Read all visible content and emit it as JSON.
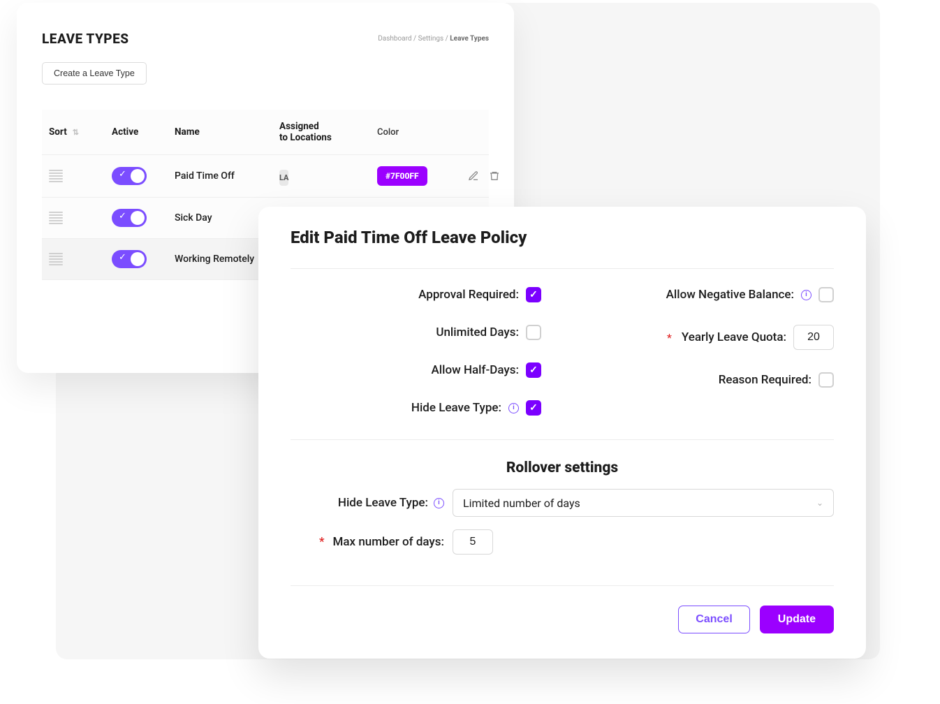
{
  "page": {
    "title": "LEAVE TYPES",
    "breadcrumb": {
      "parts": [
        "Dashboard",
        "Settings"
      ],
      "current": "Leave Types",
      "sep": " / "
    },
    "create_button": "Create a Leave Type",
    "columns": {
      "sort": "Sort",
      "active": "Active",
      "name": "Name",
      "locations_l1": "Assigned",
      "locations_l2": "to Locations",
      "color": "Color"
    },
    "rows": [
      {
        "name": "Paid Time Off",
        "location": "LA",
        "color_hex": "#7F00FF",
        "active": true
      },
      {
        "name": "Sick Day",
        "active": true
      },
      {
        "name": "Working Remotely",
        "active": true
      }
    ]
  },
  "modal": {
    "title": "Edit Paid Time Off Leave Policy",
    "left": {
      "approval_required": {
        "label": "Approval Required:",
        "checked": true
      },
      "unlimited_days": {
        "label": "Unlimited Days:",
        "checked": false
      },
      "allow_half_days": {
        "label": "Allow Half-Days:",
        "checked": true
      },
      "hide_leave_type": {
        "label": "Hide Leave Type:",
        "checked": true,
        "info": true
      }
    },
    "right": {
      "allow_negative": {
        "label": "Allow Negative Balance:",
        "checked": false,
        "info": true
      },
      "yearly_quota": {
        "label": "Yearly Leave Quota:",
        "required": true,
        "value": "20"
      },
      "reason_required": {
        "label": "Reason Required:",
        "checked": false
      }
    },
    "rollover": {
      "section_title": "Rollover settings",
      "type": {
        "label": "Hide Leave Type:",
        "info": true,
        "selected": "Limited number of days"
      },
      "max_days": {
        "label": "Max number of days:",
        "required": true,
        "value": "5"
      }
    },
    "actions": {
      "cancel": "Cancel",
      "update": "Update"
    }
  }
}
